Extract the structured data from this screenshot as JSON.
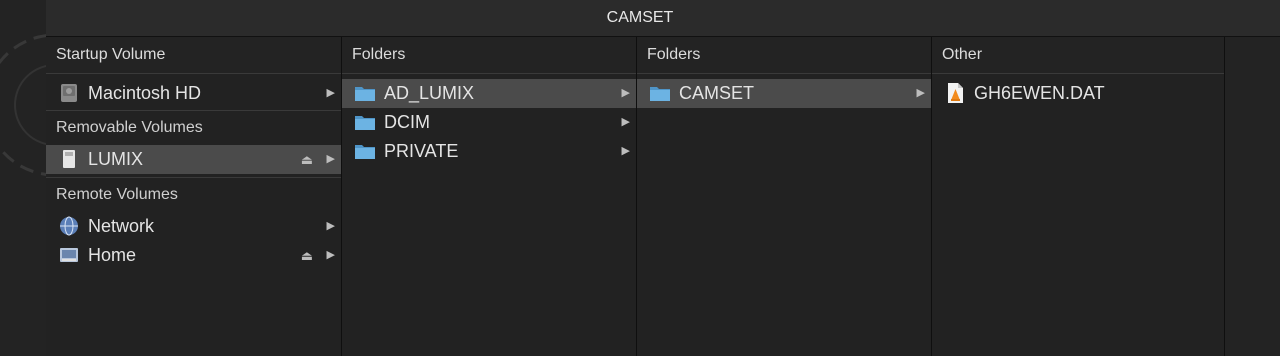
{
  "window": {
    "title": "CAMSET"
  },
  "sidebar": {
    "sections": [
      {
        "label": "Startup Volume",
        "items": [
          {
            "label": "Macintosh HD",
            "icon": "hard-drive-icon",
            "eject": false,
            "selected": false
          }
        ]
      },
      {
        "label": "Removable Volumes",
        "items": [
          {
            "label": "LUMIX",
            "icon": "sd-card-icon",
            "eject": true,
            "selected": true
          }
        ]
      },
      {
        "label": "Remote Volumes",
        "items": [
          {
            "label": "Network",
            "icon": "network-globe-icon",
            "eject": false,
            "selected": false
          },
          {
            "label": "Home",
            "icon": "home-drive-icon",
            "eject": true,
            "selected": false
          }
        ]
      }
    ]
  },
  "columns": [
    {
      "header": "Folders",
      "items": [
        {
          "label": "AD_LUMIX",
          "icon": "folder-icon",
          "selected": true
        },
        {
          "label": "DCIM",
          "icon": "folder-icon",
          "selected": false
        },
        {
          "label": "PRIVATE",
          "icon": "folder-icon",
          "selected": false
        }
      ]
    },
    {
      "header": "Folders",
      "items": [
        {
          "label": "CAMSET",
          "icon": "folder-icon",
          "selected": true
        }
      ]
    },
    {
      "header": "Other",
      "items": [
        {
          "label": "GH6EWEN.DAT",
          "icon": "vlc-file-icon",
          "selected": false
        }
      ]
    }
  ],
  "colors": {
    "selection": "#4b4b4b",
    "folder": "#5fa8d9",
    "background": "#222222"
  }
}
